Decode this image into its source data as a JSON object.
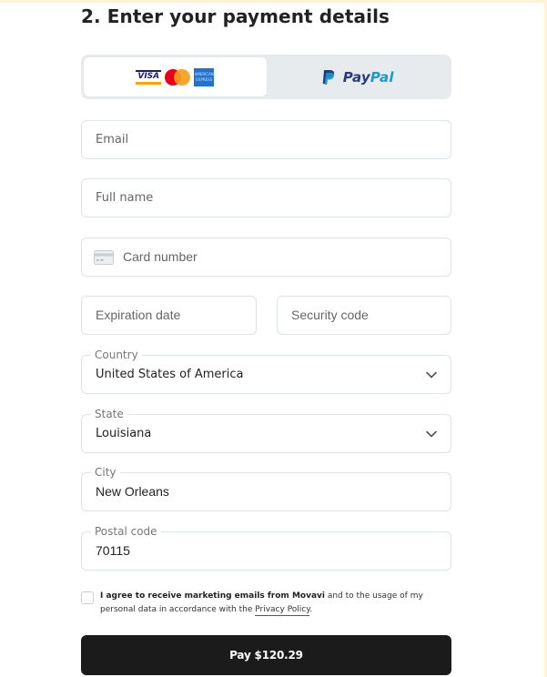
{
  "section_title": "2. Enter your payment details",
  "payment_methods": [
    {
      "id": "card",
      "active": true,
      "logos": [
        "VISA",
        "Mastercard",
        "American Express"
      ],
      "visa_text": "VISA",
      "amex_text": "AMERICAN EXPRESS"
    },
    {
      "id": "paypal",
      "active": false,
      "label_dark": "Pay",
      "label_light": "Pal"
    }
  ],
  "fields": {
    "email": {
      "placeholder": "Email",
      "value": ""
    },
    "full_name": {
      "placeholder": "Full name",
      "value": ""
    },
    "card_number": {
      "placeholder": "Card number",
      "value": "",
      "icon": "credit-card-icon"
    },
    "expiration_date": {
      "placeholder": "Expiration date",
      "value": ""
    },
    "security_code": {
      "placeholder": "Security code",
      "value": ""
    },
    "country": {
      "label": "Country",
      "value": "United States of America",
      "icon": "chevron-down-icon"
    },
    "state": {
      "label": "State",
      "value": "Louisiana",
      "icon": "chevron-down-icon"
    },
    "city": {
      "label": "City",
      "value": "New Orleans"
    },
    "postal_code": {
      "label": "Postal code",
      "value": "70115"
    }
  },
  "consent": {
    "checked": false,
    "bold_text": "I agree to receive marketing emails from Movavi",
    "text": " and to the usage of my personal data in accordance with the ",
    "link_text": "Privacy Policy",
    "suffix": "."
  },
  "pay_button": {
    "label": "Pay $120.29"
  },
  "colors": {
    "paypal_dark": "#253b80",
    "paypal_light": "#179bd7",
    "pay_button_bg": "#1b1b1b",
    "switch_bg": "#e7ebee"
  }
}
